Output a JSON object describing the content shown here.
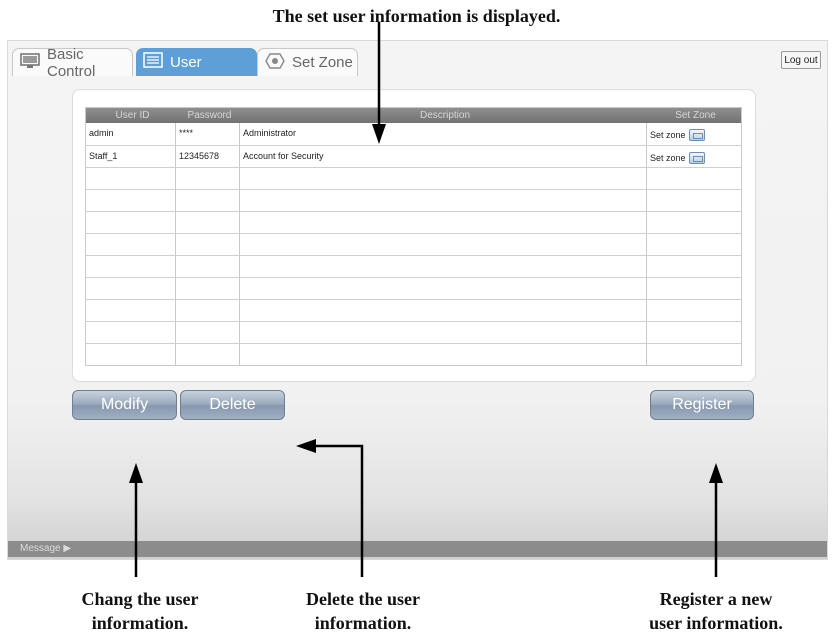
{
  "callouts": {
    "top": "The set user information is displayed.",
    "modify_line1": "Chang the user",
    "modify_line2": "information.",
    "delete_line1": "Delete the user",
    "delete_line2": "information.",
    "register_line1": "Register a new",
    "register_line2": "user information."
  },
  "tabs": [
    {
      "label": "Basic Control",
      "icon": "monitor-icon",
      "selected": false
    },
    {
      "label": "User",
      "icon": "user-list-icon",
      "selected": true
    },
    {
      "label": "Set Zone",
      "icon": "zone-icon",
      "selected": false
    }
  ],
  "logout_label": "Log out",
  "table": {
    "headers": [
      "User ID",
      "Password",
      "Description",
      "Set Zone"
    ],
    "rows": [
      {
        "user_id": "admin",
        "password": "****",
        "description": "Administrator",
        "set_zone": "Set zone"
      },
      {
        "user_id": "Staff_1",
        "password": "12345678",
        "description": "Account for Security",
        "set_zone": "Set zone"
      }
    ],
    "empty_rows": 9
  },
  "buttons": {
    "modify": "Modify",
    "delete": "Delete",
    "register": "Register"
  },
  "message_label": "Message ▶",
  "colors": {
    "tab_selected": "#5d9fd6",
    "button_gradient_top": "#c7d1dd",
    "button_gradient_bottom": "#8797ad",
    "table_header": "#7f7f7f"
  }
}
